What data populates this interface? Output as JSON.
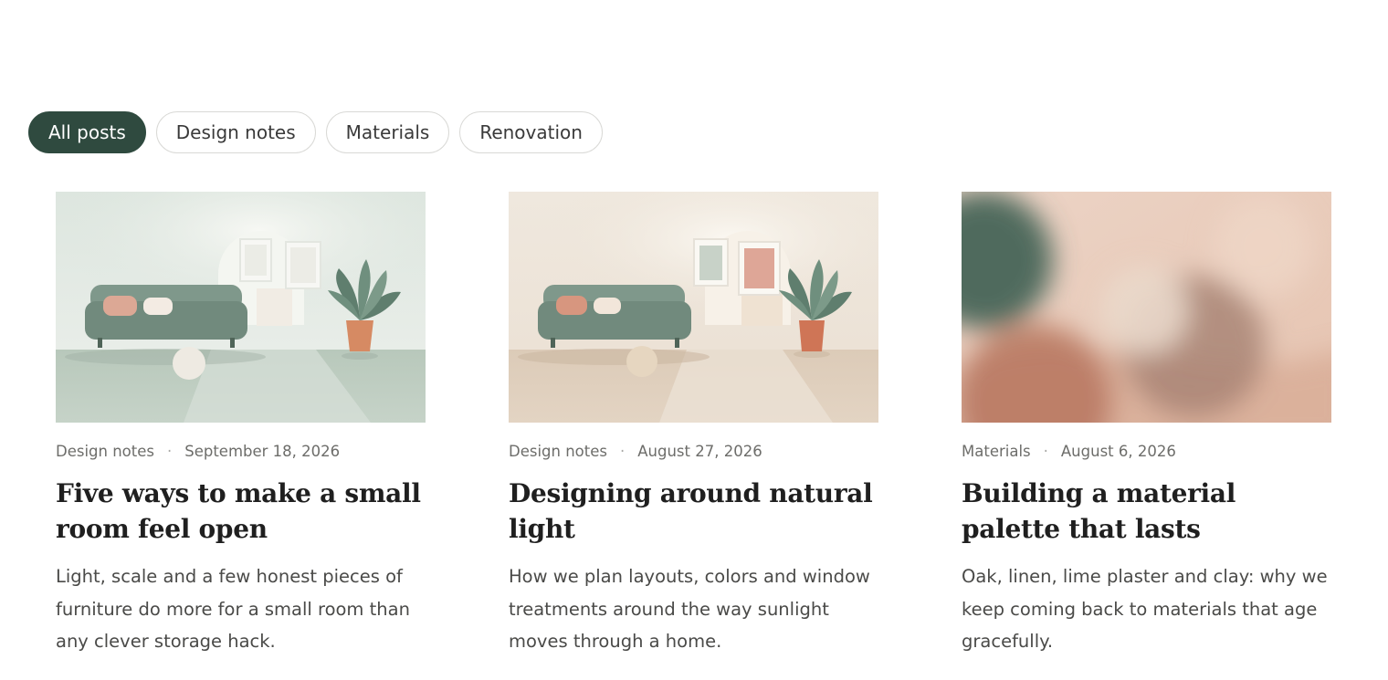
{
  "filters": [
    {
      "label": "All posts",
      "active": true
    },
    {
      "label": "Design notes",
      "active": false
    },
    {
      "label": "Materials",
      "active": false
    },
    {
      "label": "Renovation",
      "active": false
    }
  ],
  "posts": [
    {
      "category": "Design notes",
      "date": "September 18, 2026",
      "title": "Five ways to make a small room feel open",
      "excerpt": "Light, scale and a few honest pieces of furniture do more for a small room than any clever storage hack.",
      "image": "sage-living-room-illustration"
    },
    {
      "category": "Design notes",
      "date": "August 27, 2026",
      "title": "Designing around natural light",
      "excerpt": "How we plan layouts, colors and window treatments around the way sunlight moves through a home.",
      "image": "beige-living-room-illustration"
    },
    {
      "category": "Materials",
      "date": "August 6, 2026",
      "title": "Building a material palette that lasts",
      "excerpt": "Oak, linen, lime plaster and clay: why we keep coming back to materials that age gracefully.",
      "image": "blurred-material-swatches"
    }
  ],
  "colors": {
    "accent": "#2f4a3f",
    "sofa": "#7a9285",
    "plant": "#5f7d6d",
    "pot": "#d0835f",
    "clay": "#c48670"
  }
}
